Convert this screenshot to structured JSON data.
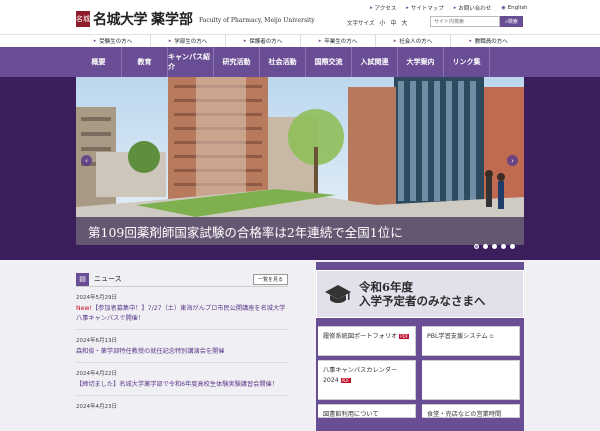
{
  "header": {
    "logo_seal": "名城",
    "logo_name": "名城大学",
    "logo_faculty": "薬学部",
    "logo_english": "Faculty of Pharmacy, Meijo University",
    "utility": [
      "アクセス",
      "サイトマップ",
      "お問い合わせ",
      "English"
    ],
    "font_size_label": "文字サイズ",
    "font_sizes": [
      "小",
      "中",
      "大"
    ],
    "search_placeholder": "サイト内検索",
    "search_button": "検索"
  },
  "audience_nav": [
    "受験生の方へ",
    "学部生の方へ",
    "保護者の方へ",
    "卒業生の方へ",
    "社会人の方へ",
    "教職員の方へ"
  ],
  "main_nav": [
    "概要",
    "教育",
    "キャンパス紹介",
    "研究活動",
    "社会活動",
    "国際交流",
    "入試関連",
    "大学案内",
    "リンク集"
  ],
  "hero": {
    "caption": "第109回薬剤師国家試験の合格率は2年連続で全国1位に",
    "prev_arrow": "‹",
    "next_arrow": "›",
    "slide_count": 5,
    "active_slide": 1
  },
  "news": {
    "title": "ニュース",
    "more": "一覧を見る",
    "items": [
      {
        "date": "2024年5月29日",
        "tag": "New!",
        "text": "【参加者募集中！】7/27（土）東海がんプロ市民公開講座を名城大学八事キャンパスで開催！"
      },
      {
        "date": "2024年6月13日",
        "tag": "",
        "text": "森和俊・薬学部特任教授の就任記念特別講演会を開催"
      },
      {
        "date": "2024年4月22日",
        "tag": "",
        "text": "【締切ました】名城大学薬学部で令和6年度高校生体験実験講習会開催！"
      },
      {
        "date": "2024年4月23日",
        "tag": "",
        "text": ""
      }
    ]
  },
  "banner": {
    "line1": "令和6年度",
    "line2": "入学予定者のみなさまへ"
  },
  "side_links": [
    {
      "label": "履修系統図ポートフォリオ",
      "icon": "pdf"
    },
    {
      "label": "PBL学習支援システム",
      "icon": "ext"
    },
    {
      "label": "八事キャンパスカレンダー2024",
      "icon": "pdf"
    },
    {
      "label": "",
      "icon": ""
    },
    {
      "label": "図書館利用について",
      "icon": ""
    },
    {
      "label": "食堂・売店などの営業時間",
      "icon": ""
    }
  ],
  "colors": {
    "brand_purple": "#6a4e95",
    "hero_bg": "#3b1f5c",
    "seal_red": "#8b1d2c",
    "new_red": "#c0102a"
  }
}
